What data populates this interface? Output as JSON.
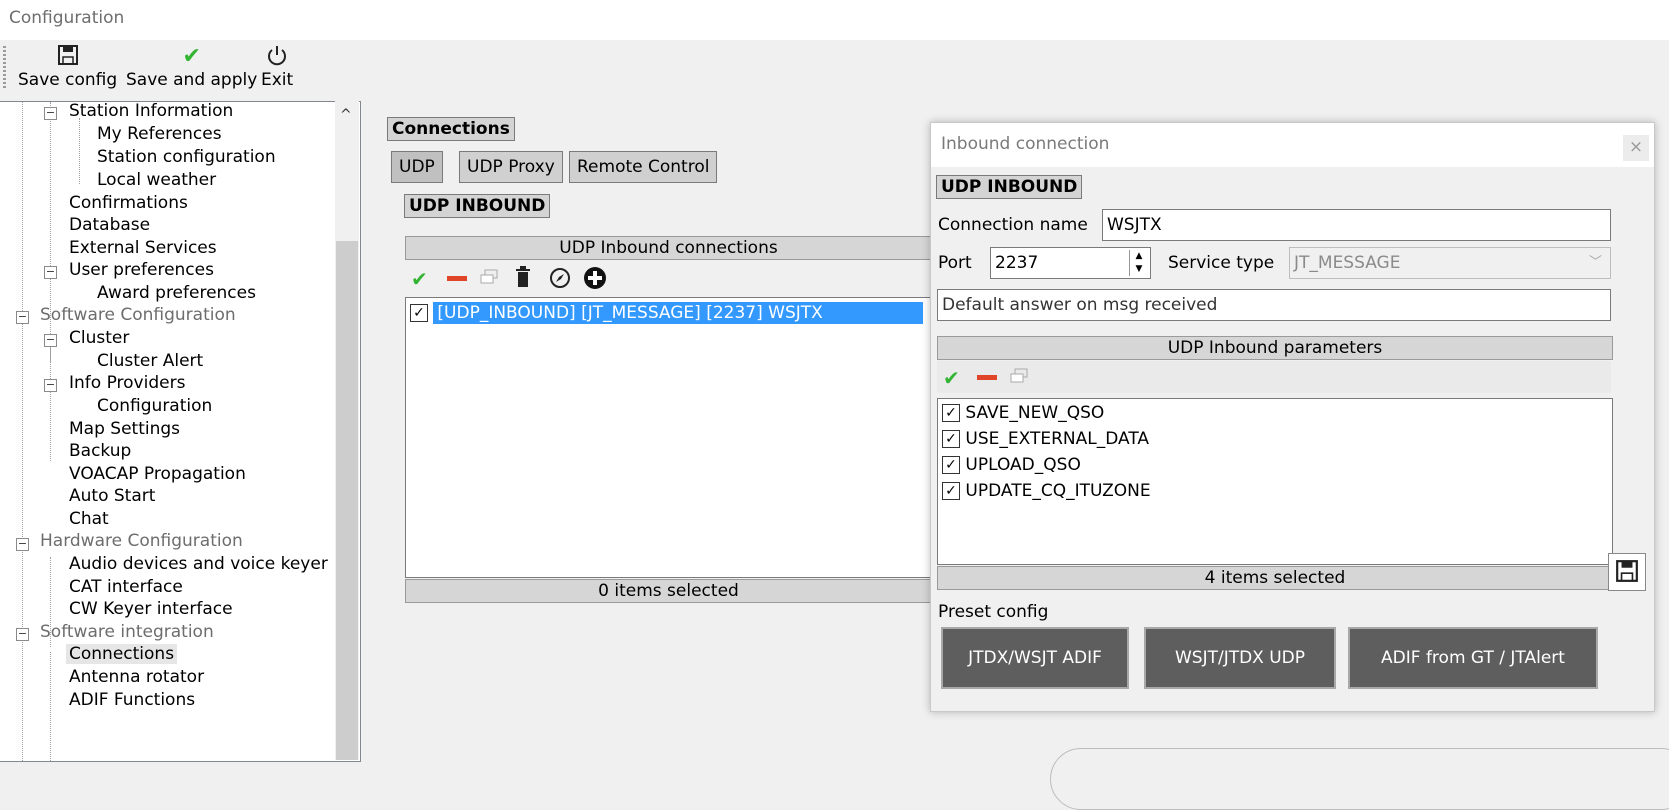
{
  "window": {
    "title": "Configuration"
  },
  "toolbar": {
    "save_config": "Save config",
    "save_apply": "Save and apply",
    "exit": "Exit"
  },
  "tree": {
    "items": [
      {
        "label": "Station Information"
      },
      {
        "label": "My References"
      },
      {
        "label": "Station configuration"
      },
      {
        "label": "Local weather"
      },
      {
        "label": "Confirmations"
      },
      {
        "label": "Database"
      },
      {
        "label": "External Services"
      },
      {
        "label": "User preferences"
      },
      {
        "label": "Award preferences"
      },
      {
        "label": "Software Configuration"
      },
      {
        "label": "Cluster"
      },
      {
        "label": "Cluster Alert"
      },
      {
        "label": "Info Providers"
      },
      {
        "label": "Configuration"
      },
      {
        "label": "Map Settings"
      },
      {
        "label": "Backup"
      },
      {
        "label": "VOACAP Propagation"
      },
      {
        "label": "Auto Start"
      },
      {
        "label": "Chat"
      },
      {
        "label": "Hardware Configuration"
      },
      {
        "label": "Audio devices and voice keyer"
      },
      {
        "label": "CAT interface"
      },
      {
        "label": "CW Keyer interface"
      },
      {
        "label": "Software integration"
      },
      {
        "label": "Connections"
      },
      {
        "label": "Antenna rotator"
      },
      {
        "label": "ADIF Functions"
      }
    ]
  },
  "main": {
    "section_title": "Connections",
    "tabs": [
      "UDP",
      "UDP Proxy",
      "Remote Control"
    ],
    "sub_title": "UDP INBOUND",
    "list_header": "UDP Inbound connections",
    "list_items": [
      "[UDP_INBOUND] [JT_MESSAGE] [2237] WSJTX"
    ],
    "list_footer": "0 items selected"
  },
  "dialog": {
    "title": "Inbound connection",
    "close": "×",
    "group_title": "UDP INBOUND",
    "connection_name_label": "Connection name",
    "connection_name_value": "WSJTX",
    "port_label": "Port",
    "port_value": "2237",
    "service_type_label": "Service type",
    "service_type_value": "JT_MESSAGE",
    "default_answer_placeholder": "Default answer on msg received",
    "params_header": "UDP Inbound parameters",
    "params": [
      "SAVE_NEW_QSO",
      "USE_EXTERNAL_DATA",
      "UPLOAD_QSO",
      "UPDATE_CQ_ITUZONE"
    ],
    "params_footer": "4 items selected",
    "preset_label": "Preset config",
    "presets": [
      "JTDX/WSJT ADIF",
      "WSJT/JTDX UDP",
      "ADIF from GT / JTAlert"
    ]
  },
  "colors": {
    "selection": "#3399ff",
    "preset_button": "#5e5e5e",
    "check_green": "#33b533",
    "remove_red": "#e0452a"
  }
}
